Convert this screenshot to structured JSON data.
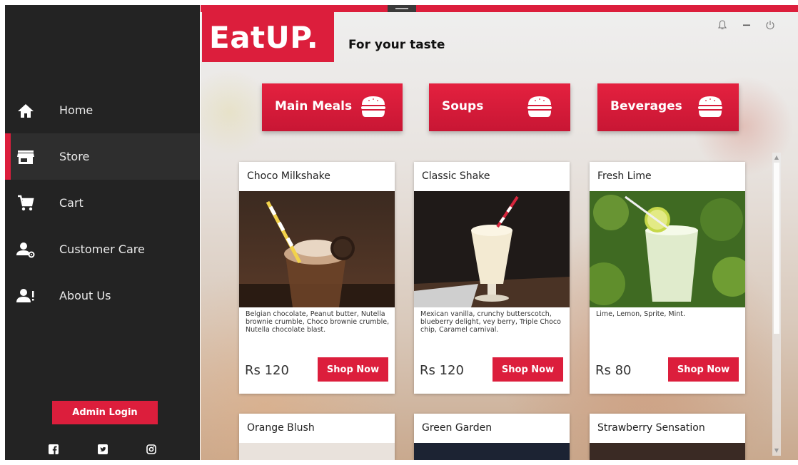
{
  "brand": {
    "logo": "EatUP.",
    "tagline": "For your taste",
    "accent": "#dc1e3c",
    "sidebar_bg": "#232323"
  },
  "window_controls": [
    "bell-icon",
    "minimize-icon",
    "power-icon"
  ],
  "sidebar": {
    "items": [
      {
        "label": "Home",
        "icon": "home-icon",
        "active": false
      },
      {
        "label": "Store",
        "icon": "store-icon",
        "active": true
      },
      {
        "label": "Cart",
        "icon": "cart-icon",
        "active": false
      },
      {
        "label": "Customer Care",
        "icon": "customer-care-icon",
        "active": false
      },
      {
        "label": "About Us",
        "icon": "about-us-icon",
        "active": false
      }
    ],
    "admin_login": "Admin Login",
    "social": [
      "facebook-icon",
      "twitter-icon",
      "instagram-icon"
    ]
  },
  "categories": [
    {
      "label": "Main Meals",
      "icon": "burger-icon"
    },
    {
      "label": "Soups",
      "icon": "burger-icon"
    },
    {
      "label": "Beverages",
      "icon": "burger-icon"
    }
  ],
  "products": [
    {
      "name": "Choco Milkshake",
      "description": "Belgian chocolate, Peanut butter, Nutella brownie crumble, Choco brownie crumble, Nutella chocolate blast.",
      "price": "Rs 120",
      "button": "Shop Now"
    },
    {
      "name": "Classic Shake",
      "description": "Mexican vanilla, crunchy butterscotch, blueberry delight, vey berry, Triple Choco chip, Caramel carnival.",
      "price": "Rs 120",
      "button": "Shop Now"
    },
    {
      "name": "Fresh Lime",
      "description": "Lime, Lemon, Sprite, Mint.",
      "price": "Rs 80",
      "button": "Shop Now"
    },
    {
      "name": "Orange Blush"
    },
    {
      "name": "Green Garden"
    },
    {
      "name": "Strawberry Sensation"
    }
  ]
}
